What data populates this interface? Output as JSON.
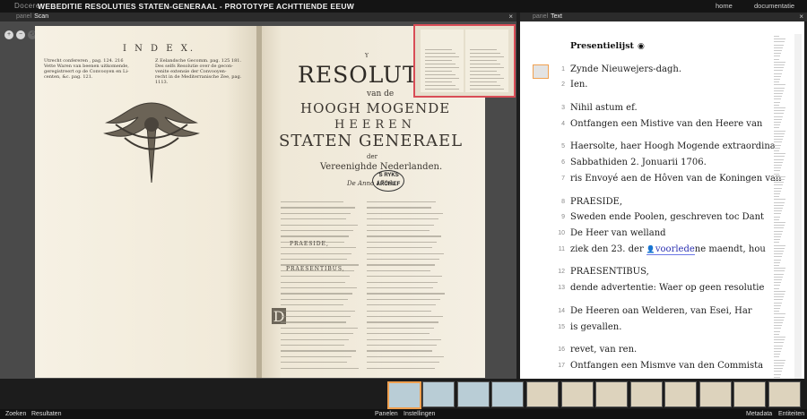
{
  "app": {
    "brand": "Docere",
    "title": "WEBEDITIE RESOLUTIES STATEN-GENERAAL - PROTOTYPE ACHTTIENDE EEUW",
    "nav": [
      "home",
      "documentatie"
    ]
  },
  "scan_panel": {
    "label_kw": "panel",
    "label": "Scan",
    "close": "×",
    "tools": [
      "+",
      "−",
      "⟲",
      "⊡"
    ],
    "facsimile": {
      "left_heading": "I N D E X.",
      "left_index_col1": [
        "Utrecht confereren , pag. 124. 216",
        "Vette Waren van beenen uitkomende,",
        "geregistreert op de Convooyen en Li-",
        "centen, &c. pag. 121."
      ],
      "left_index_col2": [
        "Z Eelandsche Gecomm. pag. 125 181.",
        "Des selfs Resolutie over de gecon-",
        "venite extensie der Convooyen-",
        "recht in de Mediterranische Zee, pag.",
        "1113."
      ],
      "right_page_no": "Y",
      "right_title_1": "RESOLUTIEN",
      "right_title_2": "van de",
      "right_title_3": "HOOGH MOGENDE",
      "right_title_4": "HEEREN",
      "right_title_5": "STATEN GENERAEL",
      "right_title_6": "der",
      "right_title_7": "Vereenighde Nederlanden.",
      "right_year": "De Anno 1706.",
      "stamp": "'S RYKS ARCHIEF",
      "col_heading": "PRAESIDE,",
      "col_heading2": "PRAESENTIBUS,",
      "drop_cap": "D"
    }
  },
  "text_panel": {
    "label_kw": "panel",
    "label": "Text",
    "close": "×",
    "title": "Presentielijst",
    "title_icon": "eye-icon",
    "lines": [
      {
        "n": "1",
        "text": "Zynde Nieuwejers-dagh."
      },
      {
        "n": "2",
        "text": "Ien."
      },
      {
        "n": "3",
        "text": "Nihil astum ef."
      },
      {
        "n": "4",
        "text": "Ontfangen een Mistive van den Heere van"
      },
      {
        "n": "5",
        "text": "Haersolte, haer Hoogh Mogende extraordina"
      },
      {
        "n": "6",
        "text": "Sabbathiden 2. Jonuarii 1706."
      },
      {
        "n": "7",
        "text": "ris Envoyé aen de Hôven van de Koningen van"
      },
      {
        "n": "8",
        "text": "PRAESIDE,"
      },
      {
        "n": "9",
        "text": "Sweden ende Poolen, geschreven toc Dant"
      },
      {
        "n": "10",
        "text": "De Heer van welland"
      },
      {
        "n": "11",
        "pre": "ziek den 23. der ",
        "entity": "voorlede",
        "post": "ne maendt, hou"
      },
      {
        "n": "12",
        "text": "PRAESENTIBUS,"
      },
      {
        "n": "13",
        "text": "dende advertentie: Waer op geen resolutie"
      },
      {
        "n": "14",
        "text": "De Heeren oan Welderen, van Esei, Har"
      },
      {
        "n": "15",
        "text": "is gevallen."
      },
      {
        "n": "16",
        "text": "revet, van ren."
      },
      {
        "n": "17",
        "text": "Ontfangen een Mismve van den Commista"
      }
    ]
  },
  "bottombar": {
    "left": [
      "Zoeken",
      "Resultaten"
    ],
    "center": [
      "Panelen",
      "Instellingen"
    ],
    "right": [
      "Metadata",
      "Entiteiten"
    ]
  },
  "colors": {
    "selection": "#f0a050",
    "minimap_frame": "#d94d56",
    "entity": "#2a2fb0"
  }
}
